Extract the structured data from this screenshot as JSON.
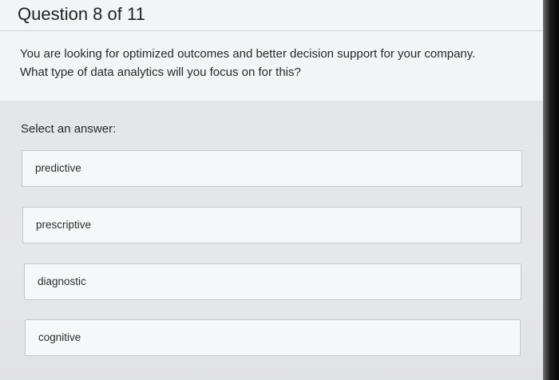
{
  "header": {
    "question_counter": "Question 8 of 11"
  },
  "question": {
    "line1": "You are looking for optimized outcomes and better decision support for your company.",
    "line2": "What type of data analytics will you focus on for this?"
  },
  "answers": {
    "prompt": "Select an answer:",
    "options": [
      {
        "label": "predictive"
      },
      {
        "label": "prescriptive"
      },
      {
        "label": "diagnostic"
      },
      {
        "label": "cognitive"
      }
    ]
  }
}
